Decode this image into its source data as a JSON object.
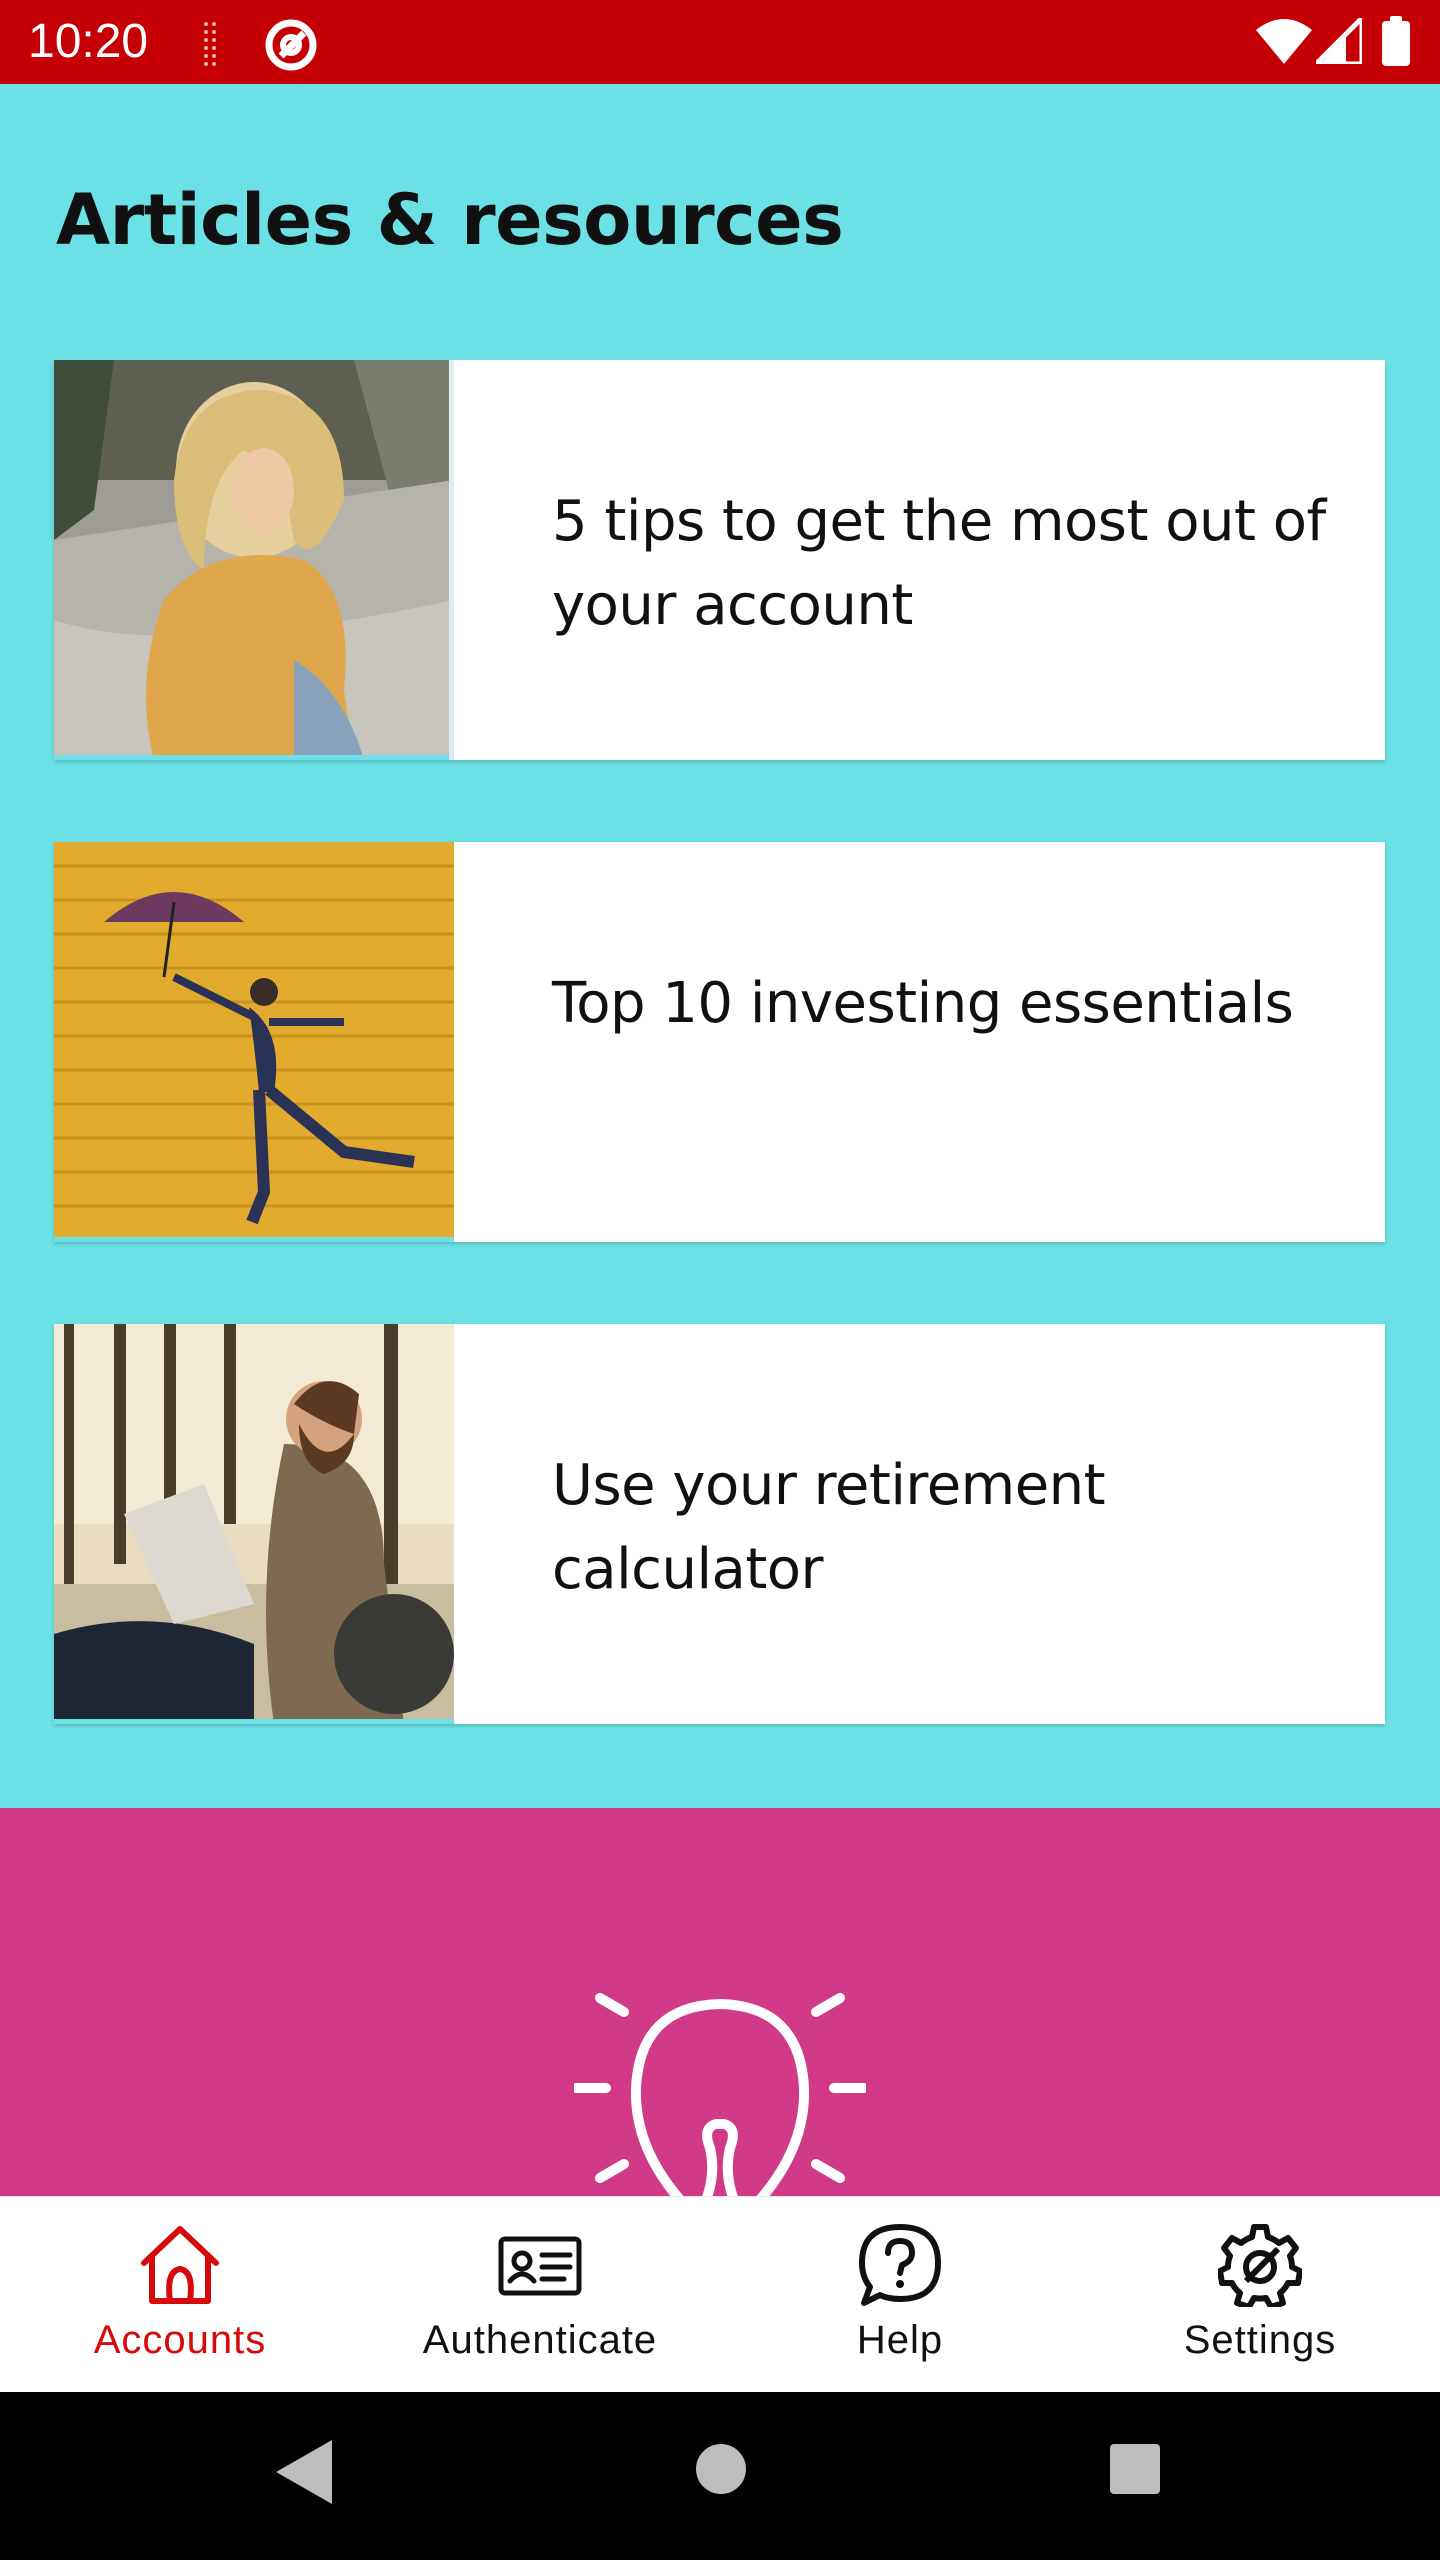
{
  "status_bar": {
    "time": "10:20",
    "icons": [
      "dots-icon",
      "app-notification-icon",
      "wifi-icon",
      "signal-icon",
      "battery-icon"
    ],
    "background": "#c40004"
  },
  "section": {
    "title": "Articles & resources",
    "background": "#6be1e6"
  },
  "articles": [
    {
      "title": "5 tips to get the most out of your account",
      "image": "woman-photo"
    },
    {
      "title": "Top 10 investing essentials",
      "image": "umbrella-jump-photo"
    },
    {
      "title": "Use your retirement calculator",
      "image": "man-laptop-photo"
    }
  ],
  "promo": {
    "icon": "lightbulb-icon",
    "background": "#d13a87"
  },
  "bottom_nav": {
    "items": [
      {
        "label": "Accounts",
        "icon": "home-icon",
        "active": true
      },
      {
        "label": "Authenticate",
        "icon": "id-card-icon",
        "active": false
      },
      {
        "label": "Help",
        "icon": "question-bubble-icon",
        "active": false
      },
      {
        "label": "Settings",
        "icon": "gear-icon",
        "active": false
      }
    ],
    "active_color": "#d50a0a"
  },
  "system_nav": {
    "icons": [
      "back-icon",
      "home-circle-icon",
      "recents-icon"
    ]
  }
}
